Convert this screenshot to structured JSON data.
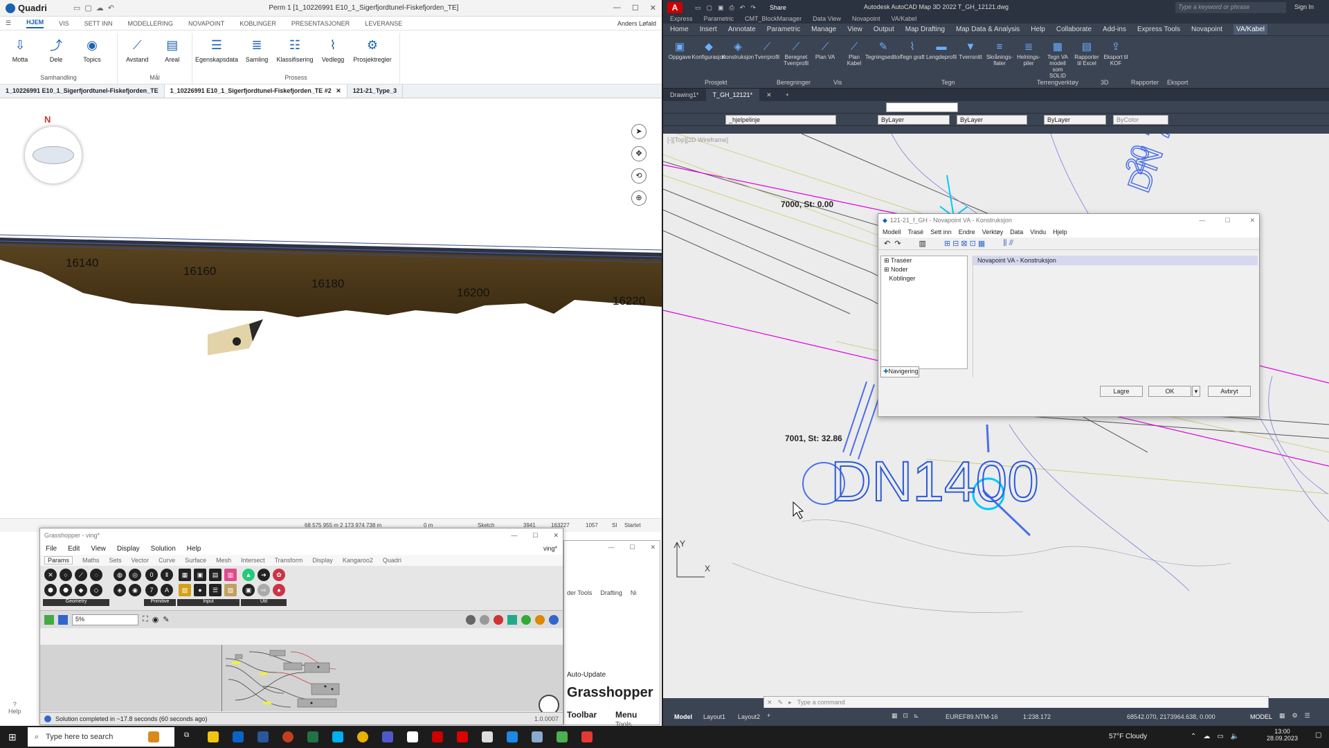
{
  "quadri": {
    "app_name": "Quadri",
    "doc_title": "Perm 1 [1_10226991 E10_1_Sigerfjordtunel-Fiskefjorden_TE]",
    "menu": [
      "HJEM",
      "VIS",
      "SETT INN",
      "MODELLERING",
      "NOVAPOINT",
      "KOBLINGER",
      "PRESENTASJONER",
      "LEVERANSE"
    ],
    "user": "Anders Løfald",
    "ribbon_groups": [
      {
        "label": "Samhandling",
        "buttons": [
          {
            "label": "Motta",
            "icon": "download-icon"
          },
          {
            "label": "Dele",
            "icon": "share-icon"
          },
          {
            "label": "Topics",
            "icon": "topics-icon"
          }
        ]
      },
      {
        "label": "Mål",
        "buttons": [
          {
            "label": "Avstand",
            "icon": "ruler-icon"
          },
          {
            "label": "Areal",
            "icon": "area-icon"
          }
        ]
      },
      {
        "label": "Prosess",
        "buttons": [
          {
            "label": "Egenskapsdata",
            "icon": "list-icon"
          },
          {
            "label": "Samling",
            "icon": "stack-icon"
          },
          {
            "label": "Klassifisering",
            "icon": "classify-icon"
          },
          {
            "label": "Vedlegg",
            "icon": "paperclip-icon"
          },
          {
            "label": "Prosjektregler",
            "icon": "rules-icon"
          }
        ]
      }
    ],
    "doc_tabs": [
      "1_10226991 E10_1_Sigerfjordtunel-Fiskefjorden_TE",
      "1_10226991 E10_1_Sigerfjordtunel-Fiskefjorden_TE #2",
      "121-21_Type_3"
    ],
    "compass_label": "N",
    "stations": [
      "16140",
      "16160",
      "16180",
      "16200",
      "16220"
    ],
    "status": {
      "coords": "68 575 955 m  2 173 974 738 m",
      "dist": "0 m",
      "mode": "Sketch",
      "count1": "3941",
      "count2": "163227",
      "count3": "1057",
      "units": "SI",
      "state": "Startet"
    }
  },
  "grasshopper": {
    "title": "Grasshopper - ving*",
    "menu": [
      "File",
      "Edit",
      "View",
      "Display",
      "Solution",
      "Help"
    ],
    "doc_name": "ving*",
    "tabs": [
      "Params",
      "Maths",
      "Sets",
      "Vector",
      "Curve",
      "Surface",
      "Mesh",
      "Intersect",
      "Transform",
      "Display",
      "Kangaroo2",
      "Quadri"
    ],
    "groups": [
      "Geometry",
      "Primitive",
      "Input",
      "Util"
    ],
    "zoom": "5%",
    "status": "Solution completed in ~17.8 seconds (60 seconds ago)",
    "version": "1.0.0007"
  },
  "grasshopper_side": {
    "tabs": [
      "der Tools",
      "Drafting",
      "Ni"
    ],
    "auto_update": "Auto-Update",
    "brand": "Grasshopper",
    "toolbar": "Toolbar",
    "menu": "Menu",
    "tools": "Tools"
  },
  "autocad": {
    "title": "Autodesk AutoCAD Map 3D 2022   T_GH_12121.dwg",
    "share": "Share",
    "search_placeholder": "Type a keyword or phrase",
    "sign_in": "Sign In",
    "subbar": [
      "Express",
      "Parametric",
      "CMT_BlockManager",
      "Data View",
      "Novapoint",
      "VA/Kabel"
    ],
    "menu": [
      "Home",
      "Insert",
      "Annotate",
      "Parametric",
      "Manage",
      "View",
      "Output",
      "Map Drafting",
      "Map Data & Analysis",
      "Help",
      "Collaborate",
      "Add-ins",
      "Express Tools",
      "Novapoint",
      "VA/Kabel"
    ],
    "ribbon_buttons": [
      "Oppgave",
      "Konfigurasjon",
      "Konstruksjon",
      "Tverrprofil",
      "Beregnet Tverrprofil",
      "Plan VA",
      "Plan Kabel",
      "Tegningseditor",
      "Tegn graft",
      "Lengdeprofil",
      "Tverrsnitt",
      "Skrånings-flater",
      "Helnings-piler",
      "Tegn VA modell som SOLID",
      "Rapporter til Excel",
      "Eksport til KOF"
    ],
    "ribbon_groups": [
      "Prosjekt",
      "Beregninger",
      "Vis",
      "Tegn",
      "Terrengverktøy",
      "3D",
      "Rapporter",
      "Eksport"
    ],
    "doc_tabs": [
      "Drawing1*",
      "T_GH_12121*"
    ],
    "layer": "_hjelpelinje",
    "color": "ByLayer",
    "linetype": "ByLayer",
    "lineweight": "ByLayer",
    "plotstyle": "ByColor",
    "viewport_label": "[-][Top][2D Wireframe]",
    "annotations": {
      "node1": "7000, St: 0.00",
      "node2": "7001, St: 32.86",
      "pipe": "DN1400",
      "text_blue": "DN 70",
      "text_blue2": "20"
    },
    "command_placeholder": "Type a command",
    "layout_tabs": [
      "Model",
      "Layout1",
      "Layout2"
    ],
    "coord_system": "EUREF89.NTM-16",
    "scale": "1:238.172",
    "coords": "68542.070, 2173964.638, 0.000",
    "space": "MODEL"
  },
  "novapoint_dialog": {
    "title": "121-21_f_GH - Novapoint VA - Konstruksjon",
    "menu": [
      "Modell",
      "Trasé",
      "Sett inn",
      "Endre",
      "Verktøy",
      "Data",
      "Vindu",
      "Hjelp"
    ],
    "tree": [
      "Traséer",
      "Noder",
      "Koblinger"
    ],
    "nav_tab": "Navigering",
    "panel_header": "Novapoint VA - Konstruksjon",
    "buttons": {
      "save": "Lagre",
      "ok": "OK",
      "cancel": "Avbryt"
    }
  },
  "taskbar": {
    "search_placeholder": "Type here to search",
    "weather": "57°F  Cloudy",
    "time": "13:00",
    "date": "28.09.2023"
  }
}
